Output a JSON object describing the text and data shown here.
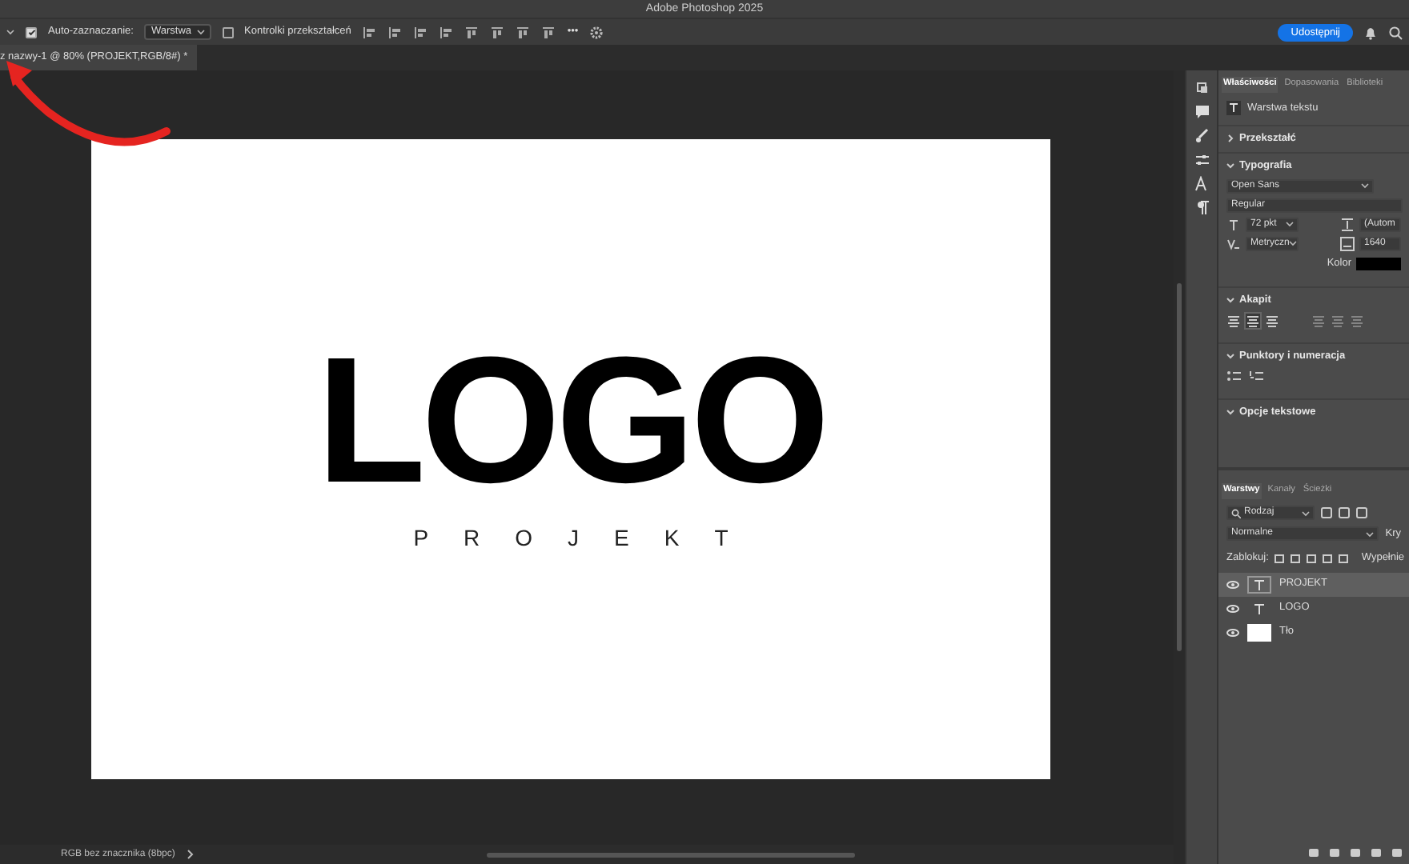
{
  "window": {
    "title": "Adobe Photoshop 2025"
  },
  "options_bar": {
    "auto_select": {
      "label": "Auto-zaznaczanie:",
      "checked": true
    },
    "auto_select_target": "Warstwa",
    "transform_controls": {
      "label": "Kontrolki przekształceń",
      "checked": false
    },
    "more": "•••",
    "share_button": "Udostępnij"
  },
  "document_tab": {
    "title": "z nazwy-1 @ 80% (PROJEKT,RGB/8#) *"
  },
  "artboard": {
    "logo": "LOGO",
    "tagline": "PROJEKT"
  },
  "properties_panel": {
    "tabs": [
      {
        "label": "Właściwości",
        "selected": true
      },
      {
        "label": "Dopasowania",
        "selected": false
      },
      {
        "label": "Biblioteki",
        "selected": false
      }
    ],
    "layer_kind": "Warstwa tekstu",
    "sections": [
      {
        "kind": "transform",
        "title": "Przekształć",
        "expanded": false
      },
      {
        "kind": "typography",
        "title": "Typografia",
        "expanded": true,
        "font": "Open Sans",
        "style": "Regular",
        "size": "72 pkt",
        "leading": "(Autom",
        "kerning": "Metryczn",
        "tracking": "1640",
        "color_label": "Kolor",
        "color": "#000000"
      },
      {
        "kind": "paragraph",
        "title": "Akapit",
        "expanded": true,
        "alignments": [
          {
            "selected": false,
            "disabled": false
          },
          {
            "selected": true,
            "disabled": false
          },
          {
            "selected": false,
            "disabled": false
          },
          {
            "selected": false,
            "disabled": true
          },
          {
            "selected": false,
            "disabled": true
          },
          {
            "selected": false,
            "disabled": true
          }
        ]
      },
      {
        "kind": "bullets",
        "title": "Punktory i numeracja",
        "expanded": true
      },
      {
        "kind": "text_options",
        "title": "Opcje tekstowe",
        "expanded": true
      }
    ]
  },
  "layers_panel": {
    "tabs": [
      {
        "label": "Warstwy",
        "selected": true
      },
      {
        "label": "Kanały",
        "selected": false
      },
      {
        "label": "Ścieżki",
        "selected": false
      }
    ],
    "filter": "Rodzaj",
    "blend_mode": "Normalne",
    "opacity_label": "Kry",
    "lock_label": "Zablokuj:",
    "fill_label": "Wypełnie",
    "layers": [
      {
        "name": "PROJEKT",
        "kind": "text",
        "selected": true,
        "visible": true
      },
      {
        "name": "LOGO",
        "kind": "text",
        "selected": false,
        "visible": true
      },
      {
        "name": "Tło",
        "kind": "fill",
        "selected": false,
        "visible": true
      }
    ]
  },
  "status_bar": {
    "color_profile": "RGB bez znacznika (8bpc)"
  }
}
